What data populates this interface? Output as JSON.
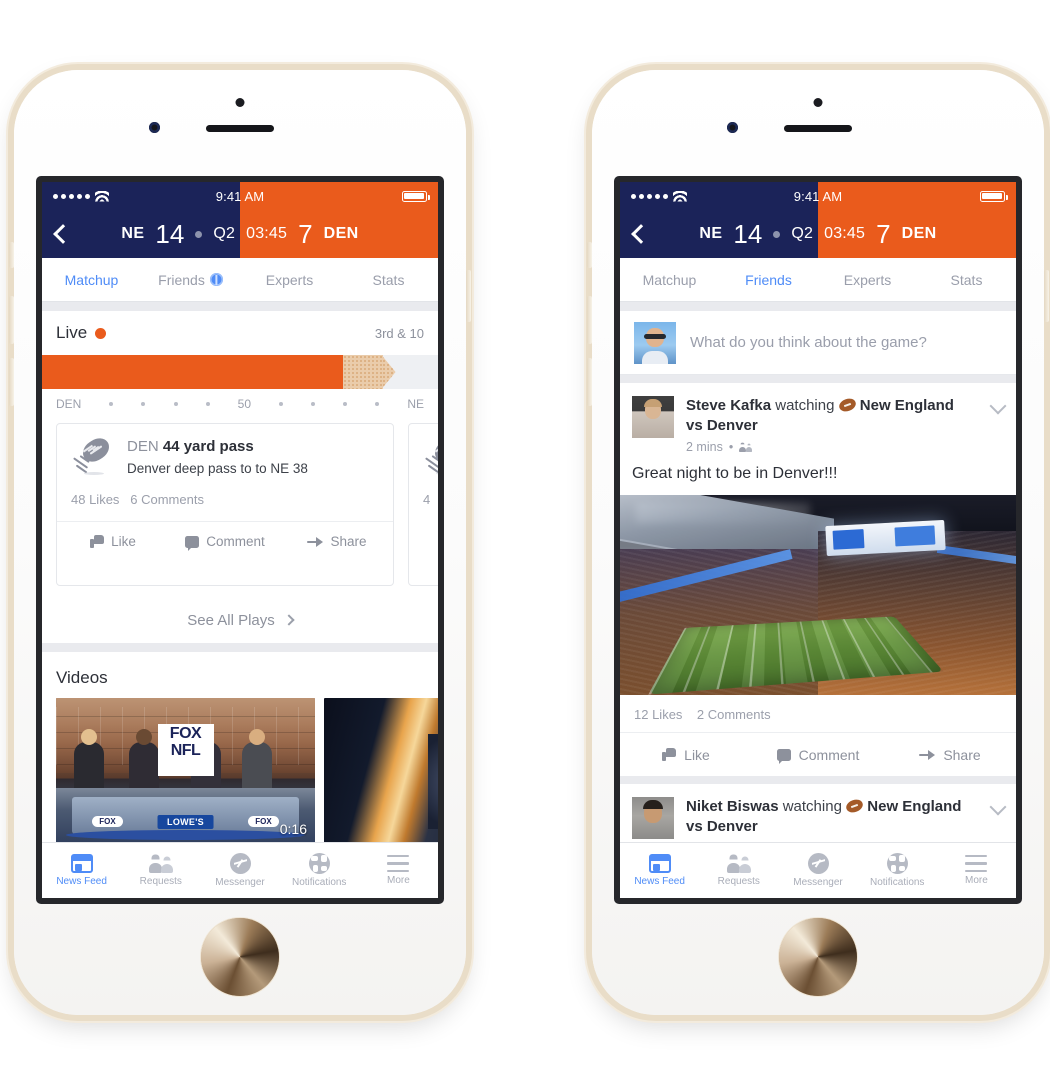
{
  "status_bar": {
    "time": "9:41 AM",
    "signal_dots": 5,
    "carrier_icons": [
      "signal-dots",
      "wifi",
      "battery"
    ]
  },
  "score_header": {
    "back_icon": "back-chevron-icon",
    "away_team": "NE",
    "away_score": "14",
    "possession_icon": "possession-dot",
    "period": "Q2",
    "clock": "03:45",
    "home_score": "7",
    "home_team": "DEN",
    "navy": "#1b2359",
    "orange": "#ea5b1c"
  },
  "tabs_left": [
    {
      "label": "Matchup",
      "active": true,
      "badge": false
    },
    {
      "label": "Friends",
      "active": false,
      "badge": true
    },
    {
      "label": "Experts",
      "active": false,
      "badge": false
    },
    {
      "label": "Stats",
      "active": false,
      "badge": false
    }
  ],
  "tabs_right": [
    {
      "label": "Matchup",
      "active": false,
      "badge": false
    },
    {
      "label": "Friends",
      "active": true,
      "badge": false
    },
    {
      "label": "Experts",
      "active": false,
      "badge": false
    },
    {
      "label": "Stats",
      "active": false,
      "badge": false
    }
  ],
  "matchup": {
    "live_label": "Live",
    "live_dot_color": "#ea5b1c",
    "down_distance": "3rd & 10",
    "field": {
      "left_endzone": "DEN",
      "right_endzone": "NE",
      "midfield": "50",
      "fill_percent": 76,
      "ghost_percent": 10,
      "tick_count": 8
    },
    "plays": [
      {
        "team": "DEN",
        "headline": "44 yard pass",
        "description": "Denver deep pass to to NE 38",
        "likes": "48 Likes",
        "comments": "6 Comments",
        "actions": [
          "Like",
          "Comment",
          "Share"
        ]
      },
      {
        "team": "",
        "headline": "",
        "description": "",
        "likes": "4",
        "comments": "",
        "actions": []
      }
    ],
    "see_all_plays": "See All Plays",
    "videos_title": "Videos",
    "videos": [
      {
        "caption": "FOX NFL studio desk",
        "duration": "0:16",
        "logos": [
          "FOX",
          "NFL",
          "LOWE'S",
          "FOX",
          "FOX"
        ]
      },
      {
        "caption": "",
        "duration": ""
      }
    ]
  },
  "friends_feed": {
    "composer_placeholder": "What do you think about the game?",
    "posts": [
      {
        "author": "Steve Kafka",
        "action": "watching",
        "game": "New England vs Denver",
        "game_line1": "New England",
        "game_line2": "vs Denver",
        "time": "2 mins",
        "audience_icon": "friends-icon",
        "body": "Great night to be in Denver!!!",
        "has_photo": true,
        "likes": "12 Likes",
        "comments": "2 Comments",
        "actions": [
          "Like",
          "Comment",
          "Share"
        ]
      },
      {
        "author": "Niket Biswas",
        "action": "watching",
        "game": "New England vs Denver",
        "game_line1": "New England",
        "game_line2": "vs Denver",
        "time": "",
        "body": "",
        "has_photo": false,
        "likes": "",
        "comments": "",
        "actions": []
      }
    ]
  },
  "bottom_nav": [
    {
      "label": "News Feed",
      "icon": "news-feed-icon",
      "active": true
    },
    {
      "label": "Requests",
      "icon": "requests-icon",
      "active": false
    },
    {
      "label": "Messenger",
      "icon": "messenger-icon",
      "active": false
    },
    {
      "label": "Notifications",
      "icon": "notifications-icon",
      "active": false
    },
    {
      "label": "More",
      "icon": "more-icon",
      "active": false
    }
  ]
}
